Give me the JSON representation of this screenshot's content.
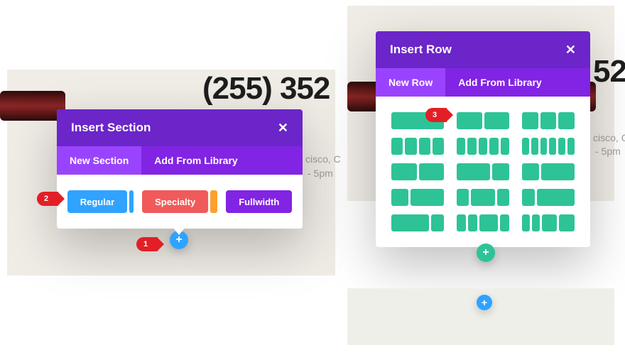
{
  "background": {
    "phone_left": "(255) 352",
    "phone_right": "52",
    "city_left": "cisco, C",
    "hours_left": "- 5pm",
    "city_right": "cisco, C",
    "hours_right": "- 5pm"
  },
  "section_modal": {
    "title": "Insert Section",
    "tabs": {
      "new": "New Section",
      "library": "Add From Library"
    },
    "buttons": {
      "regular": "Regular",
      "specialty": "Specialty",
      "fullwidth": "Fullwidth"
    }
  },
  "row_modal": {
    "title": "Insert Row",
    "tabs": {
      "new": "New Row",
      "library": "Add From Library"
    },
    "layouts": [
      [
        1,
        2,
        3
      ],
      [
        4,
        5,
        6
      ],
      [
        [
          1,
          1
        ],
        [
          2,
          1
        ],
        [
          1,
          2
        ]
      ],
      [
        [
          1,
          2
        ],
        [
          2,
          2
        ],
        [
          1,
          3
        ]
      ],
      [
        [
          3,
          1
        ],
        [
          4,
          2
        ],
        [
          2,
          4
        ]
      ]
    ]
  },
  "plus": {
    "glyph": "+"
  },
  "callouts": {
    "one": "1",
    "two": "2",
    "three": "3"
  },
  "close": {
    "glyph": "✕"
  }
}
